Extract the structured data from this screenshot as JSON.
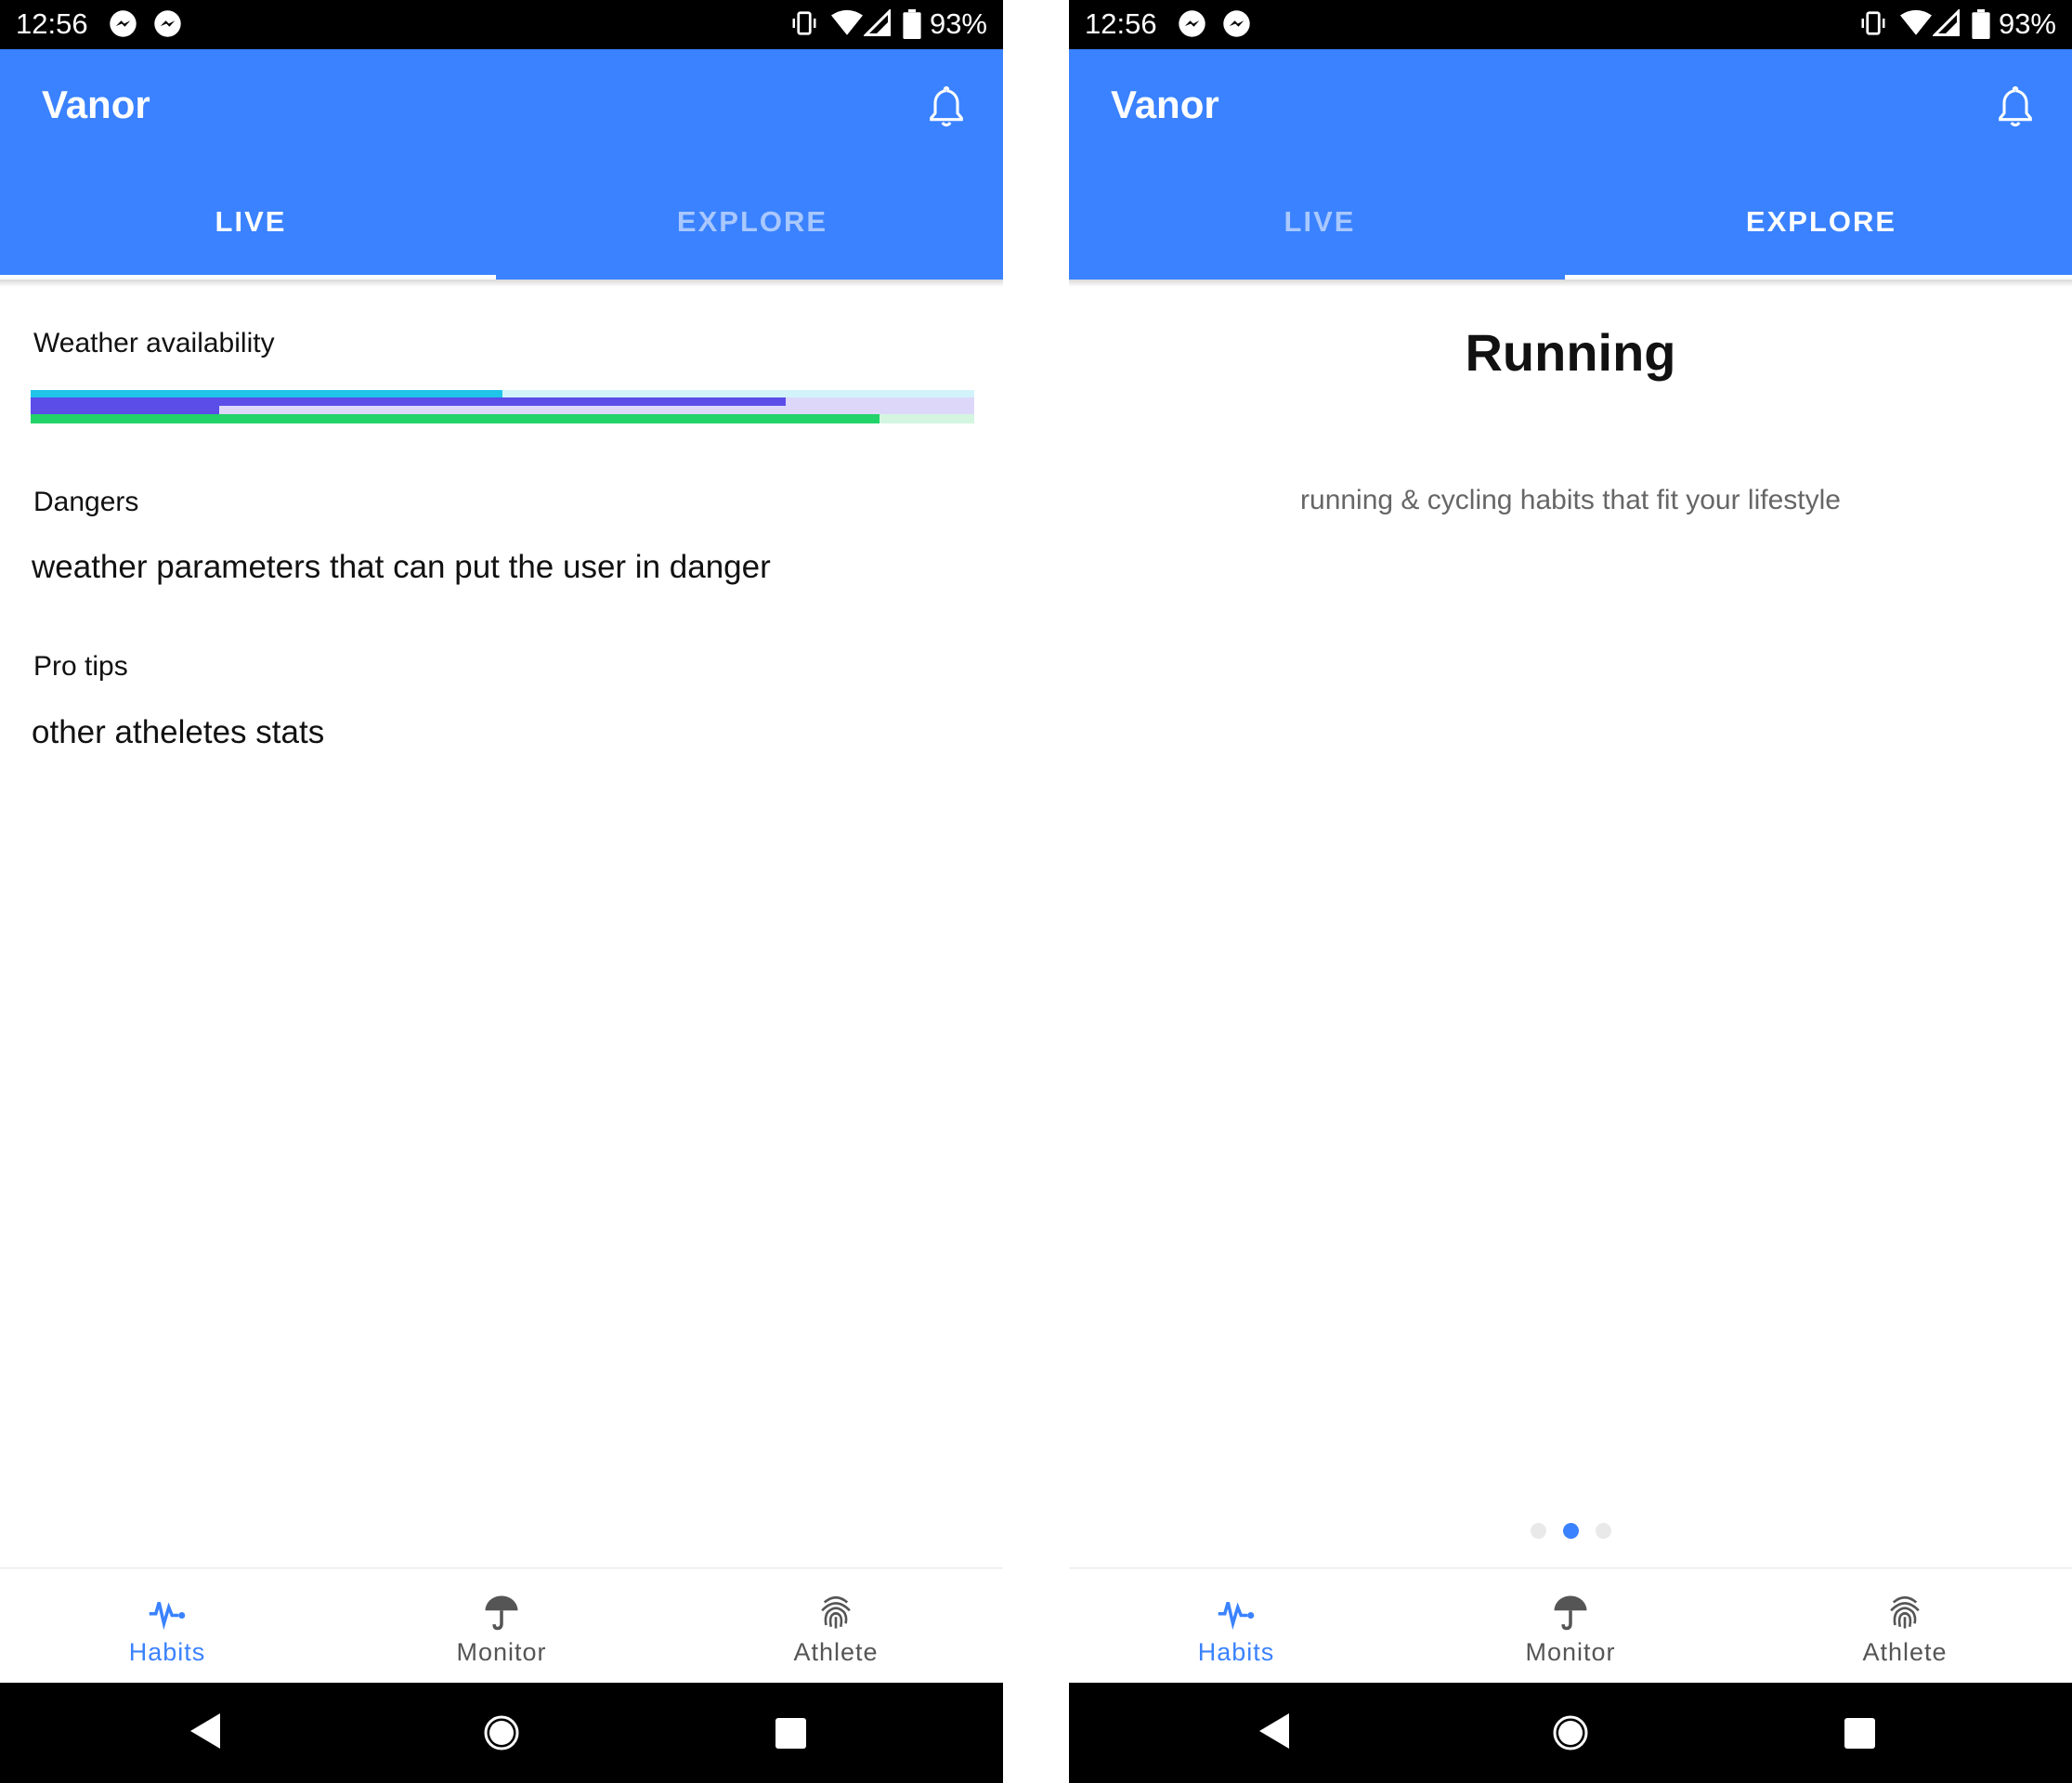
{
  "status_bar": {
    "time": "12:56",
    "battery": "93%",
    "icons": [
      "messenger-icon",
      "messenger-icon",
      "vibrate-icon",
      "wifi-icon",
      "signal-icon",
      "battery-icon"
    ]
  },
  "app": {
    "title": "Vanor",
    "accent_color": "#3a82ff"
  },
  "tabs": [
    {
      "label": "LIVE"
    },
    {
      "label": "EXPLORE"
    }
  ],
  "live": {
    "weather_label": "Weather availability",
    "weather_bars": [
      {
        "color": "#20c4e8",
        "track_color": "#d3f3fa",
        "level": 0.5
      },
      {
        "color": "#5b4de8",
        "track_color": "#ddd8fa",
        "level": 0.8
      },
      {
        "color": "#5b4de8",
        "track_color": "#ddd8fa",
        "level": 0.2
      },
      {
        "color": "#22d36a",
        "track_color": "#d4f6e1",
        "level": 0.9
      }
    ],
    "dangers_label": "Dangers",
    "dangers_text": "weather parameters that can put the user in danger",
    "protips_label": "Pro tips",
    "protips_text": "other atheletes stats"
  },
  "explore": {
    "title": "Running",
    "subtitle": "running & cycling habits that fit your lifestyle",
    "page_count": 3,
    "current_page": 2
  },
  "bottom_nav": [
    {
      "label": "Habits",
      "icon": "pulse-icon",
      "active": true
    },
    {
      "label": "Monitor",
      "icon": "umbrella-icon",
      "active": false
    },
    {
      "label": "Athlete",
      "icon": "fingerprint-icon",
      "active": false
    }
  ]
}
